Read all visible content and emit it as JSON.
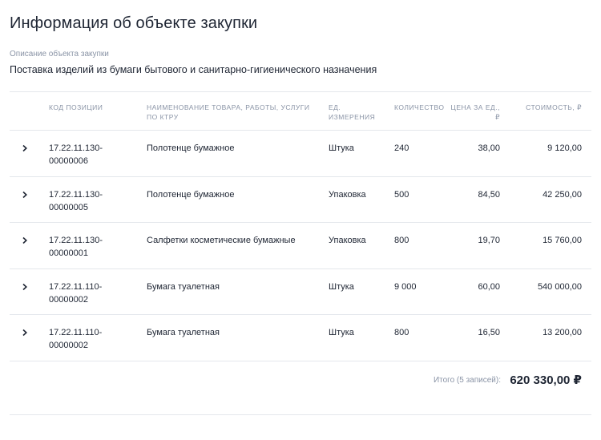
{
  "page": {
    "title": "Информация об объекте закупки",
    "description_label": "Описание объекта закупки",
    "description_value": "Поставка изделий из бумаги бытового и санитарно-гигиенического назначения"
  },
  "table": {
    "headers": {
      "code": "Код позиции",
      "name": "Наименование товара, работы, услуги по КТРУ",
      "unit": "Ед. измерения",
      "qty": "Количество",
      "price": "Цена за ед., ₽",
      "cost": "Стоимость, ₽"
    },
    "rows": [
      {
        "code": "17.22.11.130-00000006",
        "name": "Полотенце бумажное",
        "unit": "Штука",
        "qty": "240",
        "price": "38,00",
        "cost": "9 120,00"
      },
      {
        "code": "17.22.11.130-00000005",
        "name": "Полотенце бумажное",
        "unit": "Упаковка",
        "qty": "500",
        "price": "84,50",
        "cost": "42 250,00"
      },
      {
        "code": "17.22.11.130-00000001",
        "name": "Салфетки косметические бумажные",
        "unit": "Упаковка",
        "qty": "800",
        "price": "19,70",
        "cost": "15 760,00"
      },
      {
        "code": "17.22.11.110-00000002",
        "name": "Бумага туалетная",
        "unit": "Штука",
        "qty": "9 000",
        "price": "60,00",
        "cost": "540 000,00"
      },
      {
        "code": "17.22.11.110-00000002",
        "name": "Бумага туалетная",
        "unit": "Штука",
        "qty": "800",
        "price": "16,50",
        "cost": "13 200,00"
      }
    ]
  },
  "total": {
    "label": "Итого (5 записей):",
    "value": "620 330,00 ₽"
  }
}
